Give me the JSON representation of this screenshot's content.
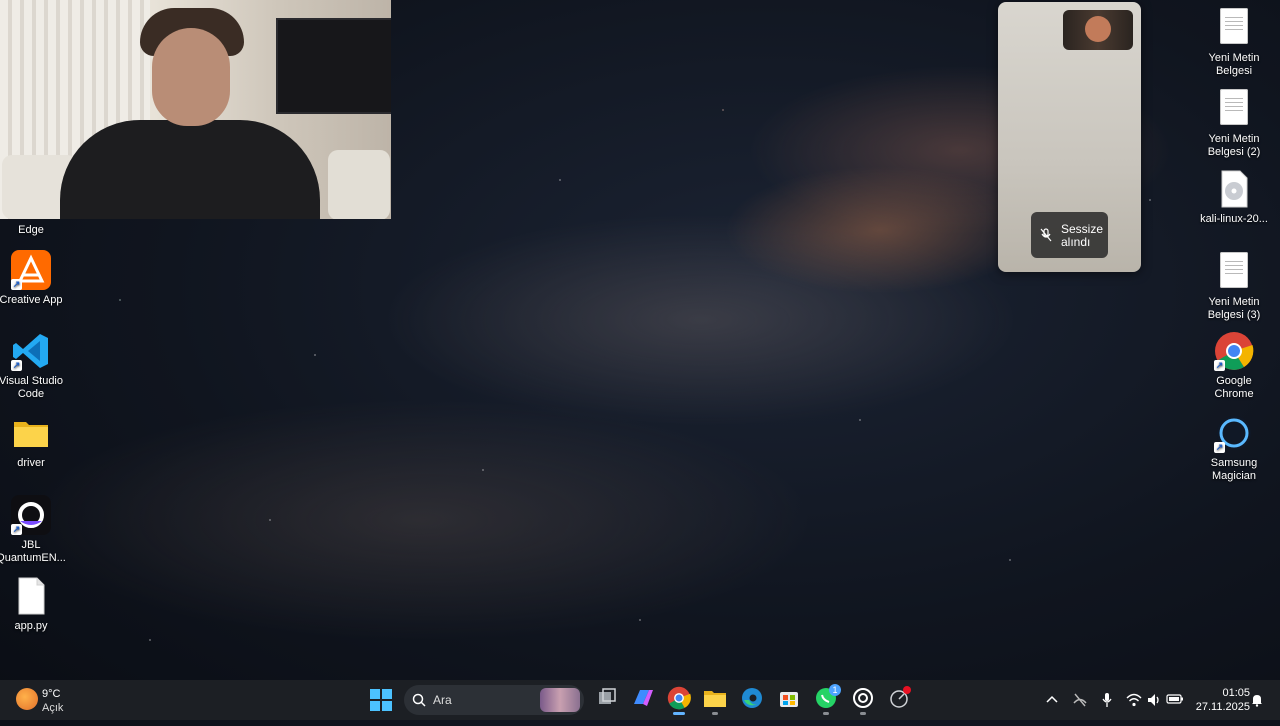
{
  "desktop": {
    "left_icons": [
      {
        "label": "Edge"
      },
      {
        "label": "Creative App"
      },
      {
        "label": "Visual Studio\nCode"
      },
      {
        "label": "driver"
      },
      {
        "label": "JBL\nQuantumEN..."
      },
      {
        "label": "app.py"
      }
    ],
    "right_icons": [
      {
        "label": "Yeni Metin\nBelgesi"
      },
      {
        "label": "Yeni Metin\nBelgesi (2)"
      },
      {
        "label": "kali-linux-20..."
      },
      {
        "label": "Yeni Metin\nBelgesi (3)"
      },
      {
        "label": "Google\nChrome"
      },
      {
        "label": "Samsung\nMagician"
      }
    ]
  },
  "call_popup": {
    "muted_label": "Sessize\nalındı"
  },
  "taskbar": {
    "weather": {
      "temp": "9°C",
      "condition": "Açık"
    },
    "search_placeholder": "Ara",
    "whatsapp_badge": "1",
    "clock": {
      "time": "01:05",
      "date": "27.11.2025"
    }
  },
  "colors": {
    "taskbar_bg": "#1c1f24",
    "active_indicator": "#63b4ff"
  }
}
